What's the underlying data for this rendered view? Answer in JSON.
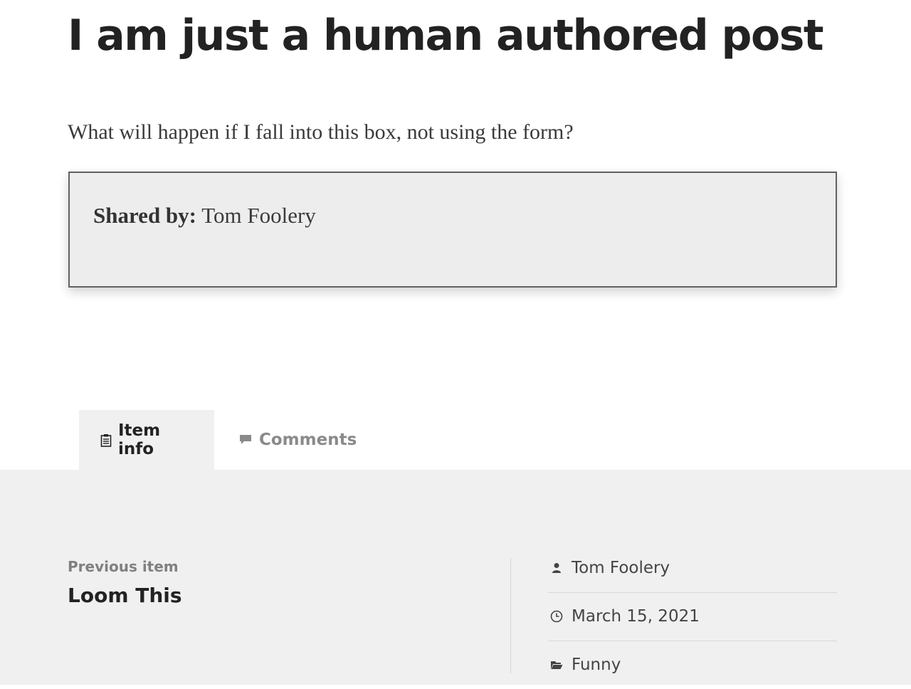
{
  "post": {
    "title": "I am just a human authored post",
    "body": "What will happen if I fall into this box, not using the form?"
  },
  "shared_box": {
    "label": "Shared by:",
    "name": "Tom Foolery"
  },
  "tabs": [
    {
      "label": "Item info",
      "icon": "clipboard-icon",
      "active": true
    },
    {
      "label": "Comments",
      "icon": "comment-icon",
      "active": false
    }
  ],
  "previous_item": {
    "label": "Previous item",
    "title": "Loom This"
  },
  "meta": {
    "author": "Tom Foolery",
    "date": "March 15, 2021",
    "category": "Funny"
  }
}
